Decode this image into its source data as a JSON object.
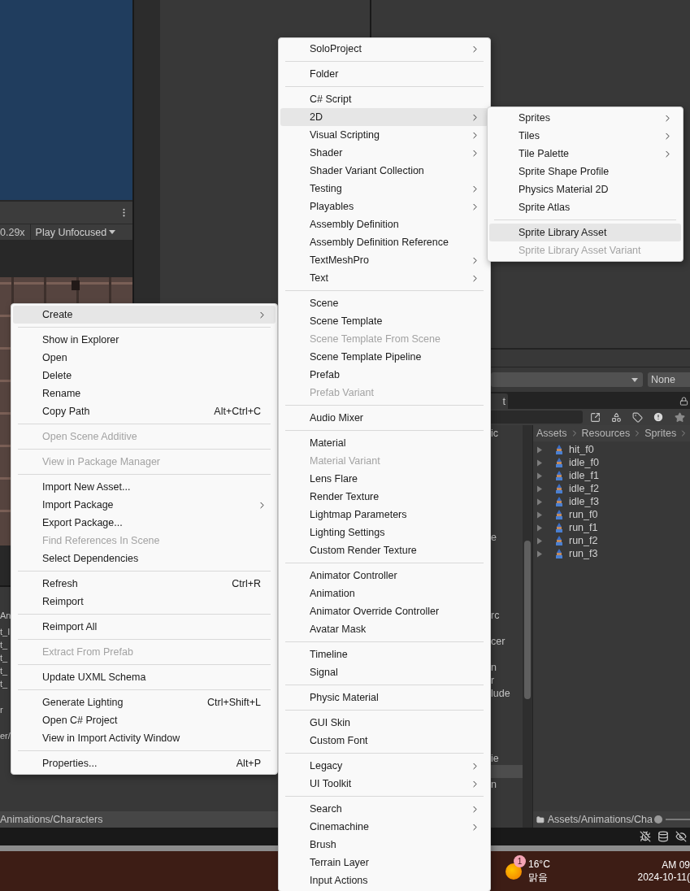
{
  "game_view": {
    "scale": "0.29x",
    "play_mode": "Play Unfocused"
  },
  "left_project": {
    "header": "An",
    "rows": [
      {
        "label": "t_I"
      },
      {
        "label": "t_"
      },
      {
        "label": "t_"
      },
      {
        "label": "t_"
      },
      {
        "label": "t_"
      },
      {},
      {
        "label": "r"
      },
      {},
      {
        "label": "er/"
      }
    ],
    "path": "Animations/Characters"
  },
  "project": {
    "filter_value": "None",
    "tab": "t",
    "tree": [
      {
        "kind": "row",
        "label": "ic",
        "selected": false
      },
      {
        "kind": "blank"
      },
      {
        "kind": "blank"
      },
      {
        "kind": "blank"
      },
      {
        "kind": "blank"
      },
      {
        "kind": "blank"
      },
      {
        "kind": "blank"
      },
      {
        "kind": "blank"
      },
      {
        "kind": "row",
        "label": "e",
        "selected": false
      },
      {
        "kind": "blank"
      },
      {
        "kind": "blank"
      },
      {
        "kind": "blank"
      },
      {
        "kind": "blank"
      },
      {
        "kind": "blank"
      },
      {
        "kind": "row",
        "label": "rc",
        "selected": false
      },
      {
        "kind": "blank"
      },
      {
        "kind": "row",
        "label": "cer",
        "selected": false
      },
      {
        "kind": "blank"
      },
      {
        "kind": "row",
        "label": "n",
        "selected": false
      },
      {
        "kind": "row",
        "label": "r",
        "selected": false
      },
      {
        "kind": "row",
        "label": "lude",
        "selected": false
      },
      {
        "kind": "blank"
      },
      {
        "kind": "blank"
      },
      {
        "kind": "blank"
      },
      {
        "kind": "blank"
      },
      {
        "kind": "row",
        "label": "ie",
        "selected": false
      },
      {
        "kind": "row",
        "selected": true
      },
      {
        "kind": "row",
        "label": "n",
        "selected": false
      }
    ],
    "breadcrumb": [
      "Assets",
      "Resources",
      "Sprites"
    ],
    "assets": [
      "hit_f0",
      "idle_f0",
      "idle_f1",
      "idle_f2",
      "idle_f3",
      "run_f0",
      "run_f1",
      "run_f2",
      "run_f3"
    ],
    "path": "Assets/Animations/Cha"
  },
  "taskbar": {
    "weather_badge": "1",
    "temperature": "16°C",
    "condition": "맑음",
    "time": "AM 09",
    "date": "2024-10-11("
  },
  "context_menu": [
    {
      "kind": "item",
      "label": "Create",
      "submenu": true,
      "disabled": false,
      "selected": true
    },
    {
      "kind": "separator"
    },
    {
      "kind": "item",
      "label": "Show in Explorer",
      "submenu": false,
      "disabled": false,
      "selected": false
    },
    {
      "kind": "item",
      "label": "Open",
      "submenu": false,
      "disabled": false,
      "selected": false
    },
    {
      "kind": "item",
      "label": "Delete",
      "submenu": false,
      "disabled": false,
      "selected": false
    },
    {
      "kind": "item",
      "label": "Rename",
      "submenu": false,
      "disabled": false,
      "selected": false
    },
    {
      "kind": "item",
      "label": "Copy Path",
      "shortcut": "Alt+Ctrl+C",
      "submenu": false,
      "disabled": false,
      "selected": false
    },
    {
      "kind": "separator"
    },
    {
      "kind": "item",
      "label": "Open Scene Additive",
      "submenu": false,
      "disabled": true,
      "selected": false
    },
    {
      "kind": "separator"
    },
    {
      "kind": "item",
      "label": "View in Package Manager",
      "submenu": false,
      "disabled": true,
      "selected": false
    },
    {
      "kind": "separator"
    },
    {
      "kind": "item",
      "label": "Import New Asset...",
      "submenu": false,
      "disabled": false,
      "selected": false
    },
    {
      "kind": "item",
      "label": "Import Package",
      "submenu": true,
      "disabled": false,
      "selected": false
    },
    {
      "kind": "item",
      "label": "Export Package...",
      "submenu": false,
      "disabled": false,
      "selected": false
    },
    {
      "kind": "item",
      "label": "Find References In Scene",
      "submenu": false,
      "disabled": true,
      "selected": false
    },
    {
      "kind": "item",
      "label": "Select Dependencies",
      "submenu": false,
      "disabled": false,
      "selected": false
    },
    {
      "kind": "separator"
    },
    {
      "kind": "item",
      "label": "Refresh",
      "shortcut": "Ctrl+R",
      "submenu": false,
      "disabled": false,
      "selected": false
    },
    {
      "kind": "item",
      "label": "Reimport",
      "submenu": false,
      "disabled": false,
      "selected": false
    },
    {
      "kind": "separator"
    },
    {
      "kind": "item",
      "label": "Reimport All",
      "submenu": false,
      "disabled": false,
      "selected": false
    },
    {
      "kind": "separator"
    },
    {
      "kind": "item",
      "label": "Extract From Prefab",
      "submenu": false,
      "disabled": true,
      "selected": false
    },
    {
      "kind": "separator"
    },
    {
      "kind": "item",
      "label": "Update UXML Schema",
      "submenu": false,
      "disabled": false,
      "selected": false
    },
    {
      "kind": "separator"
    },
    {
      "kind": "item",
      "label": "Generate Lighting",
      "shortcut": "Ctrl+Shift+L",
      "submenu": false,
      "disabled": false,
      "selected": false
    },
    {
      "kind": "item",
      "label": "Open C# Project",
      "submenu": false,
      "disabled": false,
      "selected": false
    },
    {
      "kind": "item",
      "label": "View in Import Activity Window",
      "submenu": false,
      "disabled": false,
      "selected": false
    },
    {
      "kind": "separator"
    },
    {
      "kind": "item",
      "label": "Properties...",
      "shortcut": "Alt+P",
      "submenu": false,
      "disabled": false,
      "selected": false
    }
  ],
  "create_menu": [
    {
      "kind": "item",
      "label": "SoloProject",
      "submenu": true,
      "disabled": false,
      "selected": false
    },
    {
      "kind": "separator"
    },
    {
      "kind": "item",
      "label": "Folder",
      "submenu": false,
      "disabled": false,
      "selected": false
    },
    {
      "kind": "separator"
    },
    {
      "kind": "item",
      "label": "C# Script",
      "submenu": false,
      "disabled": false,
      "selected": false
    },
    {
      "kind": "item",
      "label": "2D",
      "submenu": true,
      "disabled": false,
      "selected": true
    },
    {
      "kind": "item",
      "label": "Visual Scripting",
      "submenu": true,
      "disabled": false,
      "selected": false
    },
    {
      "kind": "item",
      "label": "Shader",
      "submenu": true,
      "disabled": false,
      "selected": false
    },
    {
      "kind": "item",
      "label": "Shader Variant Collection",
      "submenu": false,
      "disabled": false,
      "selected": false
    },
    {
      "kind": "item",
      "label": "Testing",
      "submenu": true,
      "disabled": false,
      "selected": false
    },
    {
      "kind": "item",
      "label": "Playables",
      "submenu": true,
      "disabled": false,
      "selected": false
    },
    {
      "kind": "item",
      "label": "Assembly Definition",
      "submenu": false,
      "disabled": false,
      "selected": false
    },
    {
      "kind": "item",
      "label": "Assembly Definition Reference",
      "submenu": false,
      "disabled": false,
      "selected": false
    },
    {
      "kind": "item",
      "label": "TextMeshPro",
      "submenu": true,
      "disabled": false,
      "selected": false
    },
    {
      "kind": "item",
      "label": "Text",
      "submenu": true,
      "disabled": false,
      "selected": false
    },
    {
      "kind": "separator"
    },
    {
      "kind": "item",
      "label": "Scene",
      "submenu": false,
      "disabled": false,
      "selected": false
    },
    {
      "kind": "item",
      "label": "Scene Template",
      "submenu": false,
      "disabled": false,
      "selected": false
    },
    {
      "kind": "item",
      "label": "Scene Template From Scene",
      "submenu": false,
      "disabled": true,
      "selected": false
    },
    {
      "kind": "item",
      "label": "Scene Template Pipeline",
      "submenu": false,
      "disabled": false,
      "selected": false
    },
    {
      "kind": "item",
      "label": "Prefab",
      "submenu": false,
      "disabled": false,
      "selected": false
    },
    {
      "kind": "item",
      "label": "Prefab Variant",
      "submenu": false,
      "disabled": true,
      "selected": false
    },
    {
      "kind": "separator"
    },
    {
      "kind": "item",
      "label": "Audio Mixer",
      "submenu": false,
      "disabled": false,
      "selected": false
    },
    {
      "kind": "separator"
    },
    {
      "kind": "item",
      "label": "Material",
      "submenu": false,
      "disabled": false,
      "selected": false
    },
    {
      "kind": "item",
      "label": "Material Variant",
      "submenu": false,
      "disabled": true,
      "selected": false
    },
    {
      "kind": "item",
      "label": "Lens Flare",
      "submenu": false,
      "disabled": false,
      "selected": false
    },
    {
      "kind": "item",
      "label": "Render Texture",
      "submenu": false,
      "disabled": false,
      "selected": false
    },
    {
      "kind": "item",
      "label": "Lightmap Parameters",
      "submenu": false,
      "disabled": false,
      "selected": false
    },
    {
      "kind": "item",
      "label": "Lighting Settings",
      "submenu": false,
      "disabled": false,
      "selected": false
    },
    {
      "kind": "item",
      "label": "Custom Render Texture",
      "submenu": false,
      "disabled": false,
      "selected": false
    },
    {
      "kind": "separator"
    },
    {
      "kind": "item",
      "label": "Animator Controller",
      "submenu": false,
      "disabled": false,
      "selected": false
    },
    {
      "kind": "item",
      "label": "Animation",
      "submenu": false,
      "disabled": false,
      "selected": false
    },
    {
      "kind": "item",
      "label": "Animator Override Controller",
      "submenu": false,
      "disabled": false,
      "selected": false
    },
    {
      "kind": "item",
      "label": "Avatar Mask",
      "submenu": false,
      "disabled": false,
      "selected": false
    },
    {
      "kind": "separator"
    },
    {
      "kind": "item",
      "label": "Timeline",
      "submenu": false,
      "disabled": false,
      "selected": false
    },
    {
      "kind": "item",
      "label": "Signal",
      "submenu": false,
      "disabled": false,
      "selected": false
    },
    {
      "kind": "separator"
    },
    {
      "kind": "item",
      "label": "Physic Material",
      "submenu": false,
      "disabled": false,
      "selected": false
    },
    {
      "kind": "separator"
    },
    {
      "kind": "item",
      "label": "GUI Skin",
      "submenu": false,
      "disabled": false,
      "selected": false
    },
    {
      "kind": "item",
      "label": "Custom Font",
      "submenu": false,
      "disabled": false,
      "selected": false
    },
    {
      "kind": "separator"
    },
    {
      "kind": "item",
      "label": "Legacy",
      "submenu": true,
      "disabled": false,
      "selected": false
    },
    {
      "kind": "item",
      "label": "UI Toolkit",
      "submenu": true,
      "disabled": false,
      "selected": false
    },
    {
      "kind": "separator"
    },
    {
      "kind": "item",
      "label": "Search",
      "submenu": true,
      "disabled": false,
      "selected": false
    },
    {
      "kind": "item",
      "label": "Cinemachine",
      "submenu": true,
      "disabled": false,
      "selected": false
    },
    {
      "kind": "item",
      "label": "Brush",
      "submenu": false,
      "disabled": false,
      "selected": false
    },
    {
      "kind": "item",
      "label": "Terrain Layer",
      "submenu": false,
      "disabled": false,
      "selected": false
    },
    {
      "kind": "item",
      "label": "Input Actions",
      "submenu": false,
      "disabled": false,
      "selected": false
    }
  ],
  "menu_2d": [
    {
      "kind": "item",
      "label": "Sprites",
      "submenu": true,
      "disabled": false,
      "selected": false
    },
    {
      "kind": "item",
      "label": "Tiles",
      "submenu": true,
      "disabled": false,
      "selected": false
    },
    {
      "kind": "item",
      "label": "Tile Palette",
      "submenu": true,
      "disabled": false,
      "selected": false
    },
    {
      "kind": "item",
      "label": "Sprite Shape Profile",
      "submenu": false,
      "disabled": false,
      "selected": false
    },
    {
      "kind": "item",
      "label": "Physics Material 2D",
      "submenu": false,
      "disabled": false,
      "selected": false
    },
    {
      "kind": "item",
      "label": "Sprite Atlas",
      "submenu": false,
      "disabled": false,
      "selected": false
    },
    {
      "kind": "separator"
    },
    {
      "kind": "item",
      "label": "Sprite Library Asset",
      "submenu": false,
      "disabled": false,
      "selected": true
    },
    {
      "kind": "item",
      "label": "Sprite Library Asset Variant",
      "submenu": false,
      "disabled": true,
      "selected": false
    }
  ]
}
